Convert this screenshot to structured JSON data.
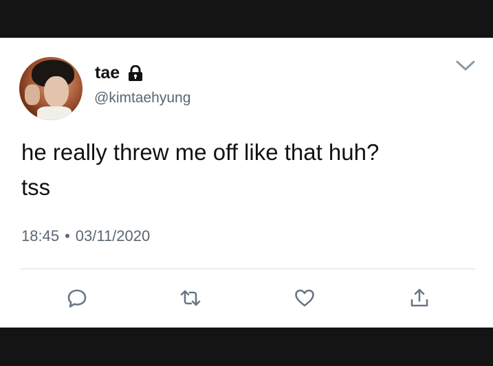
{
  "tweet": {
    "display_name": "tae",
    "handle": "@kimtaehyung",
    "text": "he really threw me off like that huh?\ntss",
    "time": "18:45",
    "separator": "•",
    "date": "03/11/2020"
  },
  "icons": {
    "lock": "lock-icon",
    "more": "chevron-down-icon",
    "reply": "reply-icon",
    "retweet": "retweet-icon",
    "like": "heart-icon",
    "share": "share-icon"
  },
  "colors": {
    "background": "#141414",
    "card": "#ffffff",
    "text": "#111111",
    "secondary_text": "#5b6670",
    "icon": "#687684",
    "divider": "#d9dde1"
  }
}
